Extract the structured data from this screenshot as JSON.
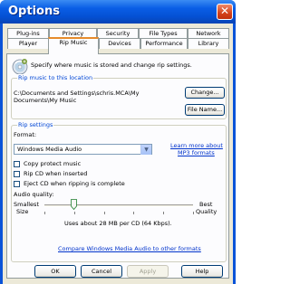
{
  "window": {
    "title": "Options",
    "close_symbol": "✕"
  },
  "tabs_row1": [
    "Plug-ins",
    "Privacy",
    "Security",
    "File Types",
    "Network"
  ],
  "tabs_row2": [
    "Player",
    "Rip Music",
    "Devices",
    "Performance",
    "Library"
  ],
  "active_tab": "Rip Music",
  "header": {
    "icon": "cd-disc-icon",
    "text": "Specify where music is stored and change rip settings."
  },
  "location": {
    "group_label": "Rip music to this location",
    "path_line1": "C:\\Documents and Settings\\schris.MCA\\My",
    "path_line2": "Documents\\My Music",
    "change_button": "Change...",
    "filename_button": "File Name..."
  },
  "rip_settings": {
    "group_label": "Rip settings",
    "format_label": "Format:",
    "format_value": "Windows Media Audio",
    "learn_more_line1": "Learn more about",
    "learn_more_line2": "MP3 formats",
    "checkboxes": [
      {
        "label": "Copy protect music",
        "checked": false
      },
      {
        "label": "Rip CD when inserted",
        "checked": false
      },
      {
        "label": "Eject CD when ripping is complete",
        "checked": false
      }
    ],
    "quality_label": "Audio quality:",
    "smallest_line1": "Smallest",
    "smallest_line2": "Size",
    "best_line1": "Best",
    "best_line2": "Quality",
    "slider_level": 0.2,
    "usage_text": "Uses about 28 MB per CD (64 Kbps).",
    "compare_link": "Compare Windows Media Audio to other formats"
  },
  "buttons": {
    "ok": "OK",
    "cancel": "Cancel",
    "apply": "Apply",
    "help": "Help"
  }
}
